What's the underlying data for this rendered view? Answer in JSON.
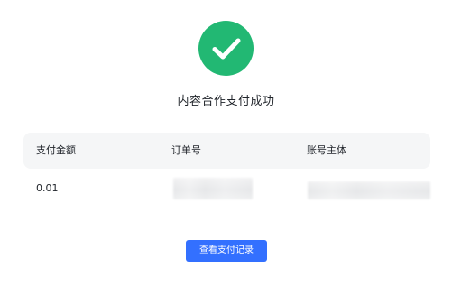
{
  "success": {
    "icon": "check-circle-icon",
    "icon_color": "#22b873",
    "title": "内容合作支付成功"
  },
  "table": {
    "headers": [
      "支付金额",
      "订单号",
      "账号主体"
    ],
    "rows": [
      {
        "amount": "0.01",
        "order_id": "",
        "account": ""
      }
    ]
  },
  "actions": {
    "view_records_label": "查看支付记录",
    "button_color": "#3370ff"
  }
}
